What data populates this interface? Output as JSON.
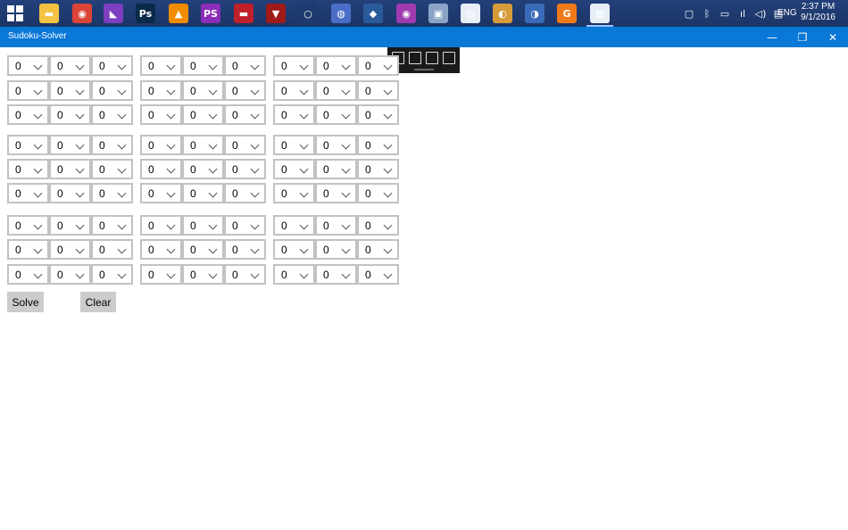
{
  "taskbar": {
    "icons": [
      {
        "name": "file-explorer-icon",
        "glyph": "▬",
        "color": "#f4c242"
      },
      {
        "name": "chrome-icon",
        "glyph": "◉",
        "color": "#db4437"
      },
      {
        "name": "visual-studio-icon",
        "glyph": "◣",
        "color": "#7d3fbf"
      },
      {
        "name": "photoshop-icon",
        "glyph": "Ps",
        "color": "#0a2a4a"
      },
      {
        "name": "vlc-icon",
        "glyph": "▲",
        "color": "#f08c00"
      },
      {
        "name": "phpstorm-icon",
        "glyph": "PS",
        "color": "#8b2db8"
      },
      {
        "name": "book-app-icon",
        "glyph": "▬",
        "color": "#c0202a"
      },
      {
        "name": "graduation-app-icon",
        "glyph": "▼",
        "color": "#a01a1a"
      },
      {
        "name": "magnifier-icon",
        "glyph": "○",
        "color": "#1f3a6e"
      },
      {
        "name": "circle-app-icon",
        "glyph": "◍",
        "color": "#4a6ec8"
      },
      {
        "name": "eye-app-icon",
        "glyph": "◆",
        "color": "#2a5a9a"
      },
      {
        "name": "purple-app-icon",
        "glyph": "◉",
        "color": "#a03ab0"
      },
      {
        "name": "network-app-icon",
        "glyph": "▣",
        "color": "#8aa4c8"
      },
      {
        "name": "document-app-icon",
        "glyph": "▤",
        "color": "#e8eef6"
      },
      {
        "name": "paint-app-icon",
        "glyph": "◐",
        "color": "#d69b3a"
      },
      {
        "name": "globe-app-icon",
        "glyph": "◑",
        "color": "#3a6ab8"
      },
      {
        "name": "orange-app-icon",
        "glyph": "G",
        "color": "#f07a1a"
      },
      {
        "name": "sudoku-app-icon",
        "glyph": "▦",
        "color": "#e6eef8"
      }
    ],
    "tray_icons": [
      "note-icon",
      "bluetooth-icon",
      "battery-icon",
      "wifi-icon",
      "volume-icon",
      "notification-icon"
    ],
    "lang": "ENG",
    "time": "2:37 PM",
    "date": "9/1/2016"
  },
  "window": {
    "title": "Sudoku-Solver",
    "minimize": "—",
    "restore": "❐",
    "close": "✕"
  },
  "grid": {
    "rows": [
      [
        "0",
        "0",
        "0",
        "0",
        "0",
        "0",
        "0",
        "0",
        "0"
      ],
      [
        "0",
        "0",
        "0",
        "0",
        "0",
        "0",
        "0",
        "0",
        "0"
      ],
      [
        "0",
        "0",
        "0",
        "0",
        "0",
        "0",
        "0",
        "0",
        "0"
      ],
      [
        "0",
        "0",
        "0",
        "0",
        "0",
        "0",
        "0",
        "0",
        "0"
      ],
      [
        "0",
        "0",
        "0",
        "0",
        "0",
        "0",
        "0",
        "0",
        "0"
      ],
      [
        "0",
        "0",
        "0",
        "0",
        "0",
        "0",
        "0",
        "0",
        "0"
      ],
      [
        "0",
        "0",
        "0",
        "0",
        "0",
        "0",
        "0",
        "0",
        "0"
      ],
      [
        "0",
        "0",
        "0",
        "0",
        "0",
        "0",
        "0",
        "0",
        "0"
      ],
      [
        "0",
        "0",
        "0",
        "0",
        "0",
        "0",
        "0",
        "0",
        "0"
      ]
    ]
  },
  "actions": {
    "solve": "Solve",
    "clear": "Clear"
  }
}
